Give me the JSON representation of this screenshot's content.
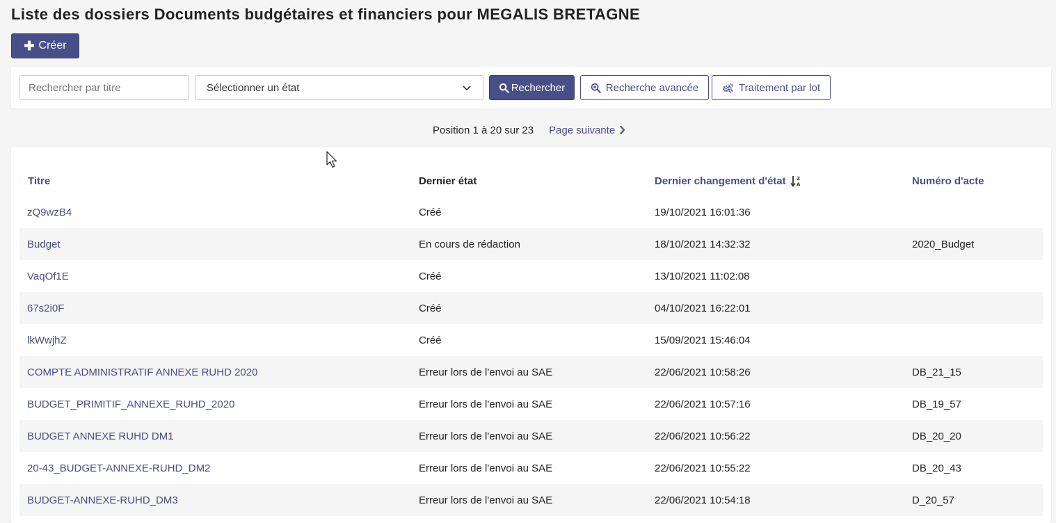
{
  "page": {
    "title": "Liste des dossiers Documents budgétaires et financiers pour MEGALIS BRETAGNE"
  },
  "toolbar": {
    "create_label": "Créer",
    "create_icon": "plus-icon"
  },
  "search": {
    "title_placeholder": "Rechercher par titre",
    "state_select_value": "Sélectionner un état",
    "search_button": "Rechercher",
    "advanced_button": "Recherche avancée",
    "batch_button": "Traitement par lot"
  },
  "pagination": {
    "position_text": "Position 1 à 20 sur 23",
    "next_label": "Page suivante"
  },
  "table": {
    "columns": {
      "title": "Titre",
      "state": "Dernier état",
      "date": "Dernier changement d'état",
      "number": "Numéro d'acte"
    },
    "sort_icon": "sort-alpha-desc-icon",
    "rows": [
      {
        "title": "zQ9wzB4",
        "state": "Créé",
        "date": "19/10/2021 16:01:36",
        "number": ""
      },
      {
        "title": "Budget",
        "state": "En cours de rédaction",
        "date": "18/10/2021 14:32:32",
        "number": "2020_Budget"
      },
      {
        "title": "VaqOf1E",
        "state": "Créé",
        "date": "13/10/2021 11:02:08",
        "number": ""
      },
      {
        "title": "67s2i0F",
        "state": "Créé",
        "date": "04/10/2021 16:22:01",
        "number": ""
      },
      {
        "title": "lkWwjhZ",
        "state": "Créé",
        "date": "15/09/2021 15:46:04",
        "number": ""
      },
      {
        "title": "COMPTE ADMINISTRATIF ANNEXE RUHD 2020",
        "state": "Erreur lors de l'envoi au SAE",
        "date": "22/06/2021 10:58:26",
        "number": "DB_21_15"
      },
      {
        "title": "BUDGET_PRIMITIF_ANNEXE_RUHD_2020",
        "state": "Erreur lors de l'envoi au SAE",
        "date": "22/06/2021 10:57:16",
        "number": "DB_19_57"
      },
      {
        "title": "BUDGET ANNEXE RUHD DM1",
        "state": "Erreur lors de l'envoi au SAE",
        "date": "22/06/2021 10:56:22",
        "number": "DB_20_20"
      },
      {
        "title": "20-43_BUDGET-ANNEXE-RUHD_DM2",
        "state": "Erreur lors de l'envoi au SAE",
        "date": "22/06/2021 10:55:22",
        "number": "DB_20_43"
      },
      {
        "title": "BUDGET-ANNEXE-RUHD_DM3",
        "state": "Erreur lors de l'envoi au SAE",
        "date": "22/06/2021 10:54:18",
        "number": "D_20_57"
      }
    ]
  },
  "colors": {
    "accent": "#474e88",
    "background": "#f5f5f5",
    "row_alt": "#f5f5f5"
  }
}
